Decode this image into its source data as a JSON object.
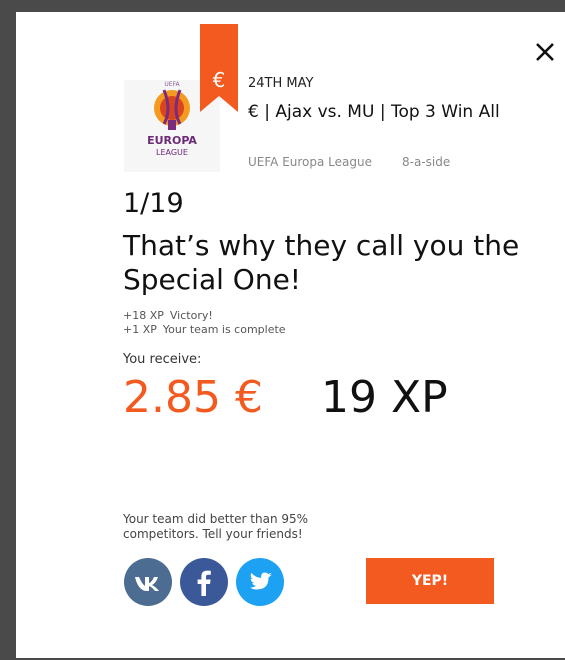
{
  "modal": {
    "close_icon": "close-icon",
    "ribbon_symbol": "€",
    "accent_color": "#f35a1f",
    "event": {
      "date": "24TH MAY",
      "title": "€ | Ajax vs. MU | Top 3 Win All",
      "league": "UEFA Europa League",
      "format": "8-a-side",
      "logo": {
        "icon": "europa-league-logo",
        "text_line1": "EUROPA",
        "text_line2": "LEAGUE",
        "text_small": "UEFA"
      }
    },
    "rank": "1/19",
    "headline": "That’s why they call you the Special One!",
    "xp_breakdown": [
      {
        "amount": "+18 XP",
        "reason": "Victory!"
      },
      {
        "amount": "+1 XP",
        "reason": "Your team is complete"
      }
    ],
    "receive_label": "You receive:",
    "reward_money": "2.85 €",
    "reward_xp": "19 XP",
    "share_text": "Your team did better than 95% competitors. Tell your friends!",
    "social": [
      {
        "name": "vk",
        "icon": "vk-icon",
        "color": "#4c6c91"
      },
      {
        "name": "facebook",
        "icon": "facebook-icon",
        "color": "#3b5998"
      },
      {
        "name": "twitter",
        "icon": "twitter-icon",
        "color": "#1da1f2"
      }
    ],
    "confirm_button": "YEP!"
  }
}
